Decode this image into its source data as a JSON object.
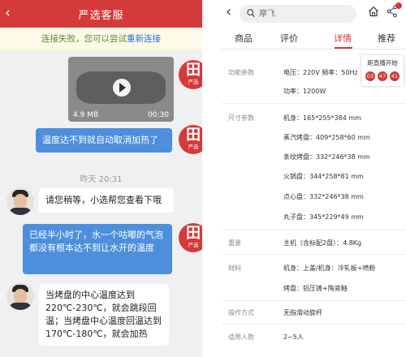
{
  "chat": {
    "title": "严选客服",
    "notice": {
      "text": "连接失败，您可以尝试",
      "link": "重新连接"
    },
    "brand_avatar_caption": "严选",
    "video": {
      "size": "4.9 MB",
      "duration": "00:30"
    },
    "msg_out_1": "温度达不到就自动取消加热了",
    "timestamp": "昨天 20:31",
    "msg_in_1": "请您稍等，小选帮您查看下哦",
    "msg_out_2": "已经半小时了，水一个咕嘟的气泡都没有根本达不到让水开的温度",
    "msg_in_2": "当烤盘的中心温度达到220℃-230℃，就会跳段回温；当烤盘中心温度回温达到170℃-180℃，就会加热"
  },
  "product": {
    "search_placeholder": "摩飞",
    "tabs": [
      "商品",
      "评价",
      "详情",
      "推荐"
    ],
    "active_tab": "详情",
    "live_title": "距直播开始",
    "countdown": [
      "03",
      "47",
      "41"
    ],
    "specs": [
      {
        "label": "功能参数",
        "values": [
          "电压：220V 频率：50Hz",
          "功率：1200W"
        ]
      },
      {
        "label": "尺寸参数",
        "values": [
          "机身：165*255*384 mm",
          "蒸汽烤盘：409*258*60 mm",
          "条纹烤盘：332*246*38 mm",
          "火锅盘：344*258*81 mm",
          "点心盘：332*246*38 mm",
          "丸子盘：345*229*49 mm"
        ]
      },
      {
        "label": "重量",
        "values": [
          "主机（含标配2盘）：4.8Kg"
        ]
      },
      {
        "label": "材料",
        "values": [
          "机身：上盖/机身：冷轧板+喷粉",
          "烤盘：铝压铸+陶瓷釉"
        ]
      },
      {
        "label": "操作方式",
        "values": [
          "无指滑动旋杆"
        ]
      },
      {
        "label": "适用人数",
        "values": [
          "2~5人"
        ]
      }
    ]
  }
}
